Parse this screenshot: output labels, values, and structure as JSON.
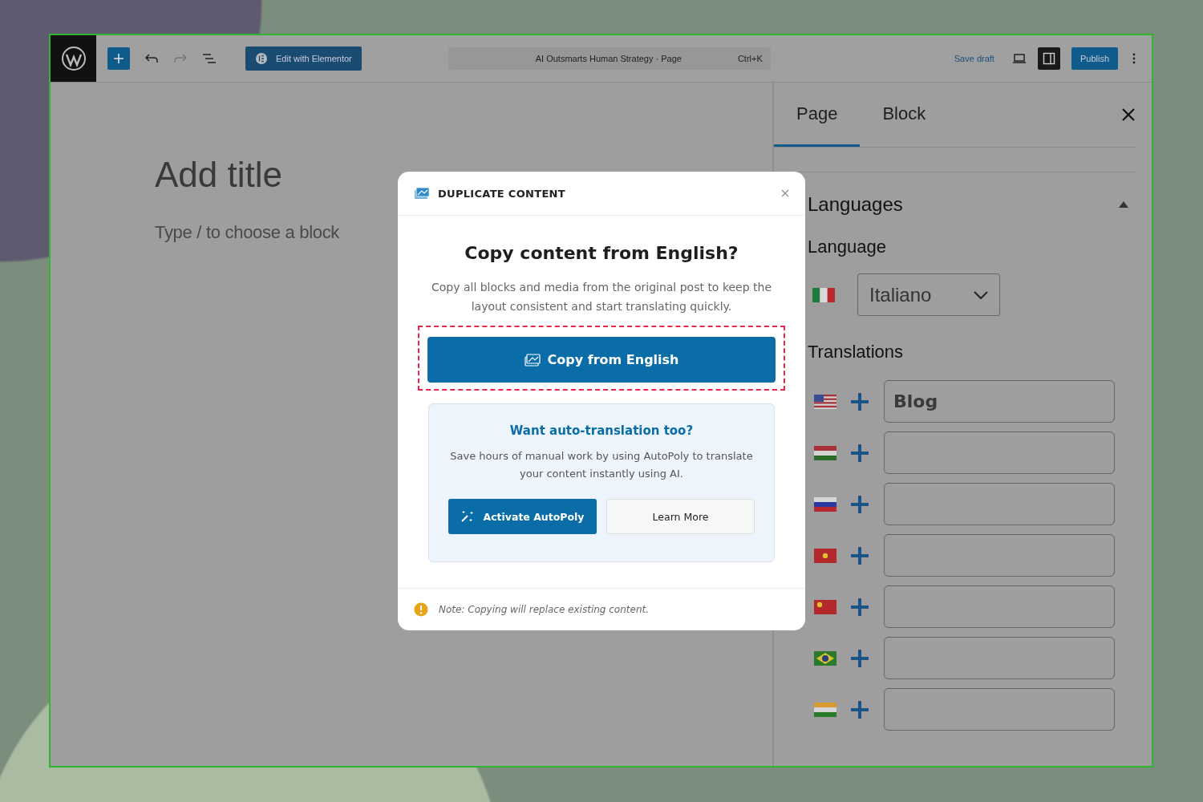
{
  "toolbar": {
    "redo_disabled": true,
    "edit_button": "Edit with Elementor",
    "command_bar": {
      "title": "AI Outsmarts Human Strategy · Page",
      "shortcut": "Ctrl+K"
    },
    "save_draft": "Save draft",
    "settings_toggle_on": true,
    "publish": "Publish"
  },
  "editor": {
    "title_placeholder": "Add title",
    "block_placeholder": "Type / to choose a block"
  },
  "sidebar": {
    "tabs": [
      {
        "label": "Page",
        "selected": true
      },
      {
        "label": "Block",
        "selected": false
      }
    ],
    "languages_panel": {
      "title": "Languages",
      "expanded": true,
      "language_label": "Language",
      "language": {
        "kind": "it",
        "value": "Italiano"
      },
      "translations_label": "Translations",
      "translations": [
        {
          "kind": "us",
          "value": "Blog"
        },
        {
          "kind": "hu"
        },
        {
          "kind": "ru"
        },
        {
          "kind": "vn"
        },
        {
          "kind": "cn"
        },
        {
          "kind": "br"
        },
        {
          "kind": "in"
        }
      ]
    }
  },
  "dialog": {
    "title": "DUPLICATE CONTENT",
    "heading": "Copy content from English?",
    "description": "Copy all blocks and media from the original post to keep the layout consistent and start translating quickly.",
    "primary_button": {
      "label": "Copy from English",
      "highlighted": true
    },
    "promo": {
      "title": "Want auto-translation too?",
      "text": "Save hours of manual work by using AutoPoly to translate your content instantly using AI.",
      "buttons": [
        {
          "kind": "primary",
          "label": "Activate AutoPoly"
        },
        {
          "kind": "secondary",
          "label": "Learn More"
        }
      ]
    },
    "note": "Note: Copying will replace existing content."
  }
}
